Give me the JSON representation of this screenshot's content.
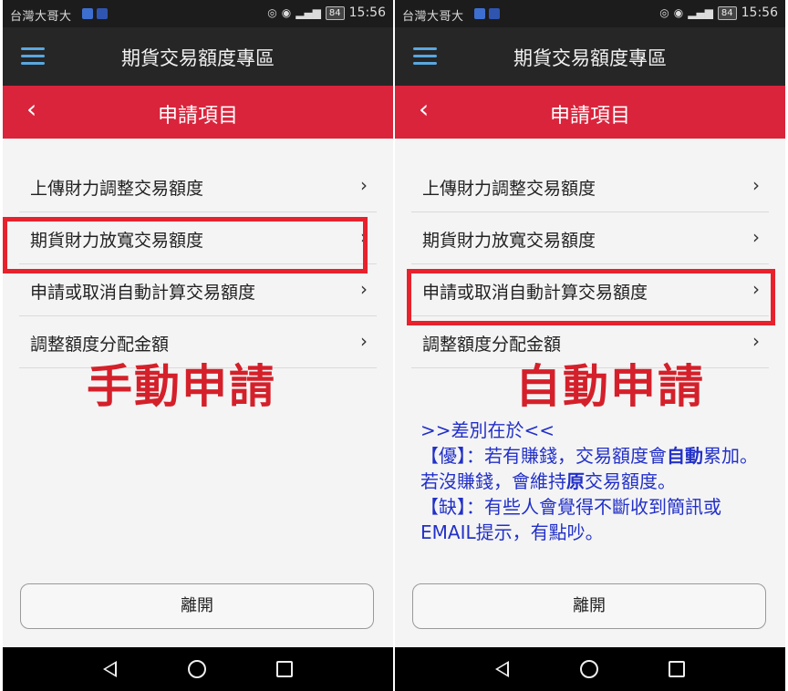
{
  "status_bar": {
    "carrier": "台灣大哥大",
    "battery": "84",
    "time": "15:56"
  },
  "app_bar": {
    "title": "期貨交易額度專區"
  },
  "sub_bar": {
    "title": "申請項目"
  },
  "menu": {
    "items": [
      {
        "label": "上傳財力調整交易額度"
      },
      {
        "label": "期貨財力放寬交易額度"
      },
      {
        "label": "申請或取消自動計算交易額度"
      },
      {
        "label": "調整額度分配金額"
      }
    ]
  },
  "leave_button": {
    "label": "離開"
  },
  "left_panel": {
    "overlay": "手動申請"
  },
  "right_panel": {
    "overlay": "自動申請",
    "note": {
      "heading": ">>差別在於<<",
      "pro_prefix": "【優】：",
      "pro_text": "若有賺錢，交易額度會",
      "pro_bold": "自動",
      "pro_text2": "累加。",
      "pro2_text": "若沒賺錢，會維持",
      "pro2_bold": "原",
      "pro2_text2": "交易額度。",
      "con_prefix": "【缺】：",
      "con_text": "有些人會覺得不斷收到簡訊或EMAIL提示，有點吵。"
    }
  },
  "colors": {
    "subbar_red": "#d9243c",
    "highlight_red": "#e8222c",
    "overlay_red": "#d4202a",
    "note_blue": "#2230c8",
    "hamburger_blue": "#5aa7e0"
  }
}
